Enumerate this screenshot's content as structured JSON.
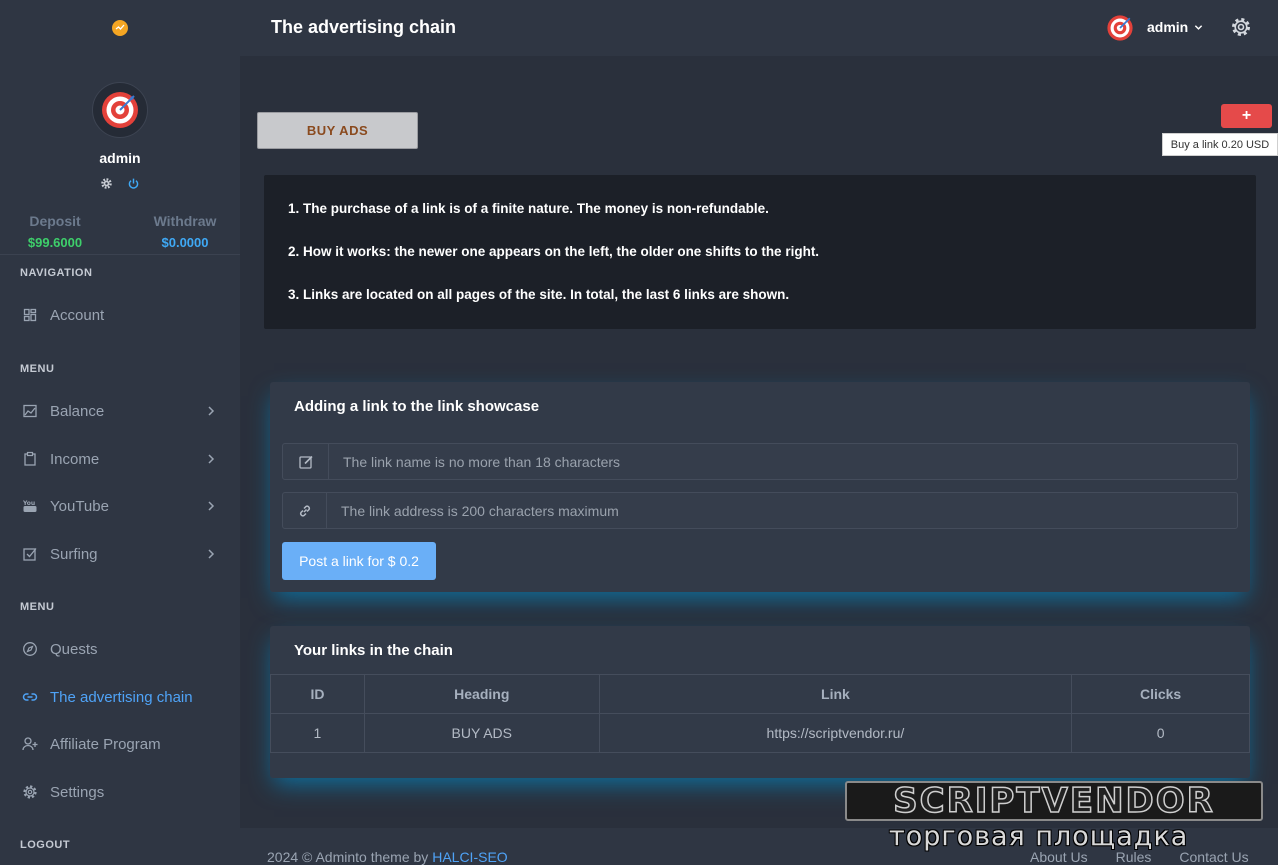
{
  "header": {
    "title": "The advertising chain",
    "user": "admin"
  },
  "sidebar": {
    "user_name": "admin",
    "deposit_label": "Deposit",
    "deposit_value": "$99.6000",
    "withdraw_label": "Withdraw",
    "withdraw_value": "$0.0000",
    "navigation_heading": "NAVIGATION",
    "menu_heading_1": "MENU",
    "menu_heading_2": "MENU",
    "logout_heading": "LOGOUT",
    "items": [
      {
        "label": "Account",
        "icon": "dashboard-icon"
      },
      {
        "label": "Balance",
        "icon": "chart-icon"
      },
      {
        "label": "Income",
        "icon": "clipboard-icon"
      },
      {
        "label": "YouTube",
        "icon": "youtube-icon"
      },
      {
        "label": "Surfing",
        "icon": "checkbox-icon"
      },
      {
        "label": "Quests",
        "icon": "compass-icon"
      },
      {
        "label": "The advertising chain",
        "icon": "link-icon"
      },
      {
        "label": "Affiliate Program",
        "icon": "user-plus-icon"
      },
      {
        "label": "Settings",
        "icon": "gear-icon"
      }
    ]
  },
  "main": {
    "buy_ads_label": "BUY ADS",
    "plus_label": "+",
    "tooltip": "Buy a link 0.20 USD",
    "notice": [
      "1. The purchase of a link is of a finite nature. The money is non-refundable.",
      "2. How it works: the newer one appears on the left, the older one shifts to the right.",
      "3. Links are located on all pages of the site. In total, the last 6 links are shown."
    ],
    "form": {
      "title": "Adding a link to the link showcase",
      "name_placeholder": "The link name is no more than 18 characters",
      "address_placeholder": "The link address is 200 characters maximum",
      "submit_label": "Post a link for $ 0.2"
    },
    "links_table": {
      "title": "Your links in the chain",
      "columns": [
        "ID",
        "Heading",
        "Link",
        "Clicks"
      ],
      "rows": [
        [
          "1",
          "BUY ADS",
          "https://scriptvendor.ru/",
          "0"
        ]
      ]
    }
  },
  "footer": {
    "copyright": "2024 © Adminto theme by ",
    "author": "HALCI-SEO",
    "links": [
      "About Us",
      "Rules",
      "Contact Us"
    ]
  },
  "watermark": {
    "top": "SCRIPTVENDOR",
    "bottom": "торговая площадка"
  },
  "colors": {
    "accent": "#4fa3f7",
    "deposit": "#3ecf6b",
    "danger": "#e54a4a"
  }
}
